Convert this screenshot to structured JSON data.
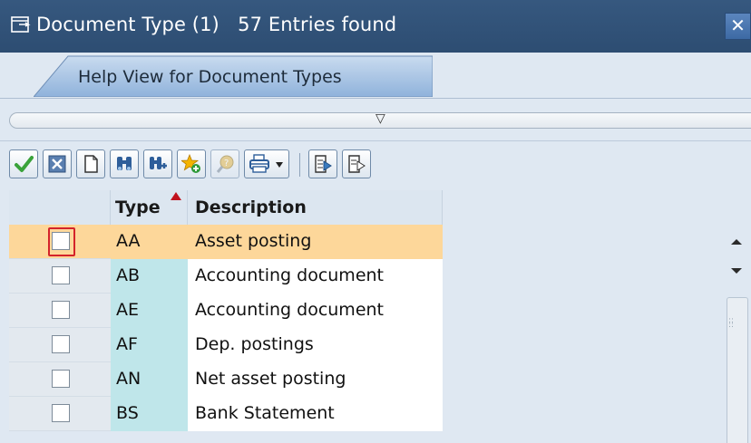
{
  "window": {
    "title": "Document Type (1)   57 Entries found",
    "close_glyph": "✕"
  },
  "tabs": [
    {
      "label": "Help View for Document Types",
      "active": true
    }
  ],
  "splitter": {
    "arrow_glyph": "▽"
  },
  "toolbar": {
    "buttons": [
      {
        "icon": "checkmark-icon",
        "tooltip": "Continue"
      },
      {
        "icon": "cancel-icon",
        "tooltip": "Cancel"
      },
      {
        "icon": "new-document-icon",
        "tooltip": "New"
      },
      {
        "icon": "find-icon",
        "tooltip": "Find"
      },
      {
        "icon": "find-next-icon",
        "tooltip": "Find Next"
      },
      {
        "icon": "favorite-add-icon",
        "tooltip": "Add to Favorites"
      },
      {
        "icon": "help-icon",
        "tooltip": "Help"
      },
      {
        "icon": "print-icon",
        "tooltip": "Print"
      },
      {
        "icon": "export-icon",
        "tooltip": "Export"
      },
      {
        "icon": "import-icon",
        "tooltip": "Import"
      }
    ]
  },
  "table": {
    "columns": [
      "Type",
      "Description"
    ],
    "sort_column": "Type",
    "rows": [
      {
        "type": "AA",
        "description": "Asset posting",
        "selected": true
      },
      {
        "type": "AB",
        "description": "Accounting document",
        "selected": false
      },
      {
        "type": "AE",
        "description": "Accounting document",
        "selected": false
      },
      {
        "type": "AF",
        "description": "Dep. postings",
        "selected": false
      },
      {
        "type": "AN",
        "description": "Net asset posting",
        "selected": false
      },
      {
        "type": "BS",
        "description": "Bank Statement",
        "selected": false
      }
    ]
  },
  "colors": {
    "title_bar": "#2d4d72",
    "key_column": "#bfe6ea",
    "selected_row": "#fdd79a",
    "sort_indicator": "#c0121d"
  }
}
